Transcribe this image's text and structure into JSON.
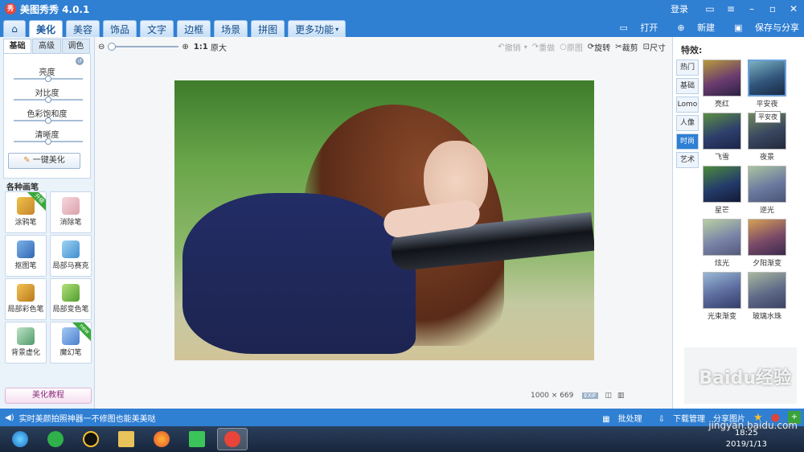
{
  "window": {
    "title": "美图秀秀 4.0.1",
    "login": "登录"
  },
  "nav": {
    "tabs": [
      "美化",
      "美容",
      "饰品",
      "文字",
      "边框",
      "场景",
      "拼图"
    ],
    "more": "更多功能",
    "open": "打开",
    "new": "新建",
    "save": "保存与分享"
  },
  "left": {
    "subtabs": [
      "基础",
      "高级",
      "调色"
    ],
    "sliders": [
      {
        "label": "亮度",
        "value": 0.5
      },
      {
        "label": "对比度",
        "value": 0.5
      },
      {
        "label": "色彩饱和度",
        "value": 0.5
      },
      {
        "label": "清晰度",
        "value": 0.5
      }
    ],
    "onekey": "一键美化",
    "brush_title": "各种画笔",
    "tools": [
      {
        "label": "涂鸦笔",
        "ribbon": "升级"
      },
      {
        "label": "消除笔",
        "ribbon": ""
      },
      {
        "label": "抠图笔",
        "ribbon": ""
      },
      {
        "label": "局部马赛克",
        "ribbon": ""
      },
      {
        "label": "局部彩色笔",
        "ribbon": ""
      },
      {
        "label": "局部变色笔",
        "ribbon": ""
      },
      {
        "label": "背景虚化",
        "ribbon": ""
      },
      {
        "label": "魔幻笔",
        "ribbon": "new"
      }
    ],
    "tutorial": "美化教程"
  },
  "toolbar": {
    "zoom_ratio": "1:1",
    "zoom_label": "原大",
    "undo": "撤销",
    "redo": "重做",
    "original": "原图",
    "rotate": "旋转",
    "crop": "裁剪",
    "resize": "尺寸"
  },
  "image": {
    "width": "1000",
    "x": "×",
    "height": "669"
  },
  "right": {
    "title": "特效:",
    "categories": [
      "热门",
      "基础",
      "Lomo",
      "人像",
      "时尚",
      "艺术"
    ],
    "active_category": "时尚",
    "effects": [
      "亮红",
      "平安夜",
      "飞雪",
      "夜景",
      "星芒",
      "逆光",
      "炫光",
      "夕阳渐变",
      "光束渐变",
      "玻璃水珠"
    ],
    "tooltip": "平安夜"
  },
  "status": {
    "message": "实时美颜拍照神器一不修图也能美美哒",
    "batch": "批处理",
    "download": "下载管理",
    "share": "分享图片"
  },
  "taskbar": {
    "time": "18:25",
    "date": "2019/1/13"
  },
  "watermark": {
    "brand": "Baidu经验",
    "url": "jingyan.baidu.com"
  },
  "colors": {
    "accent": "#2f7fd3",
    "active_category": "#2f7fd3"
  }
}
